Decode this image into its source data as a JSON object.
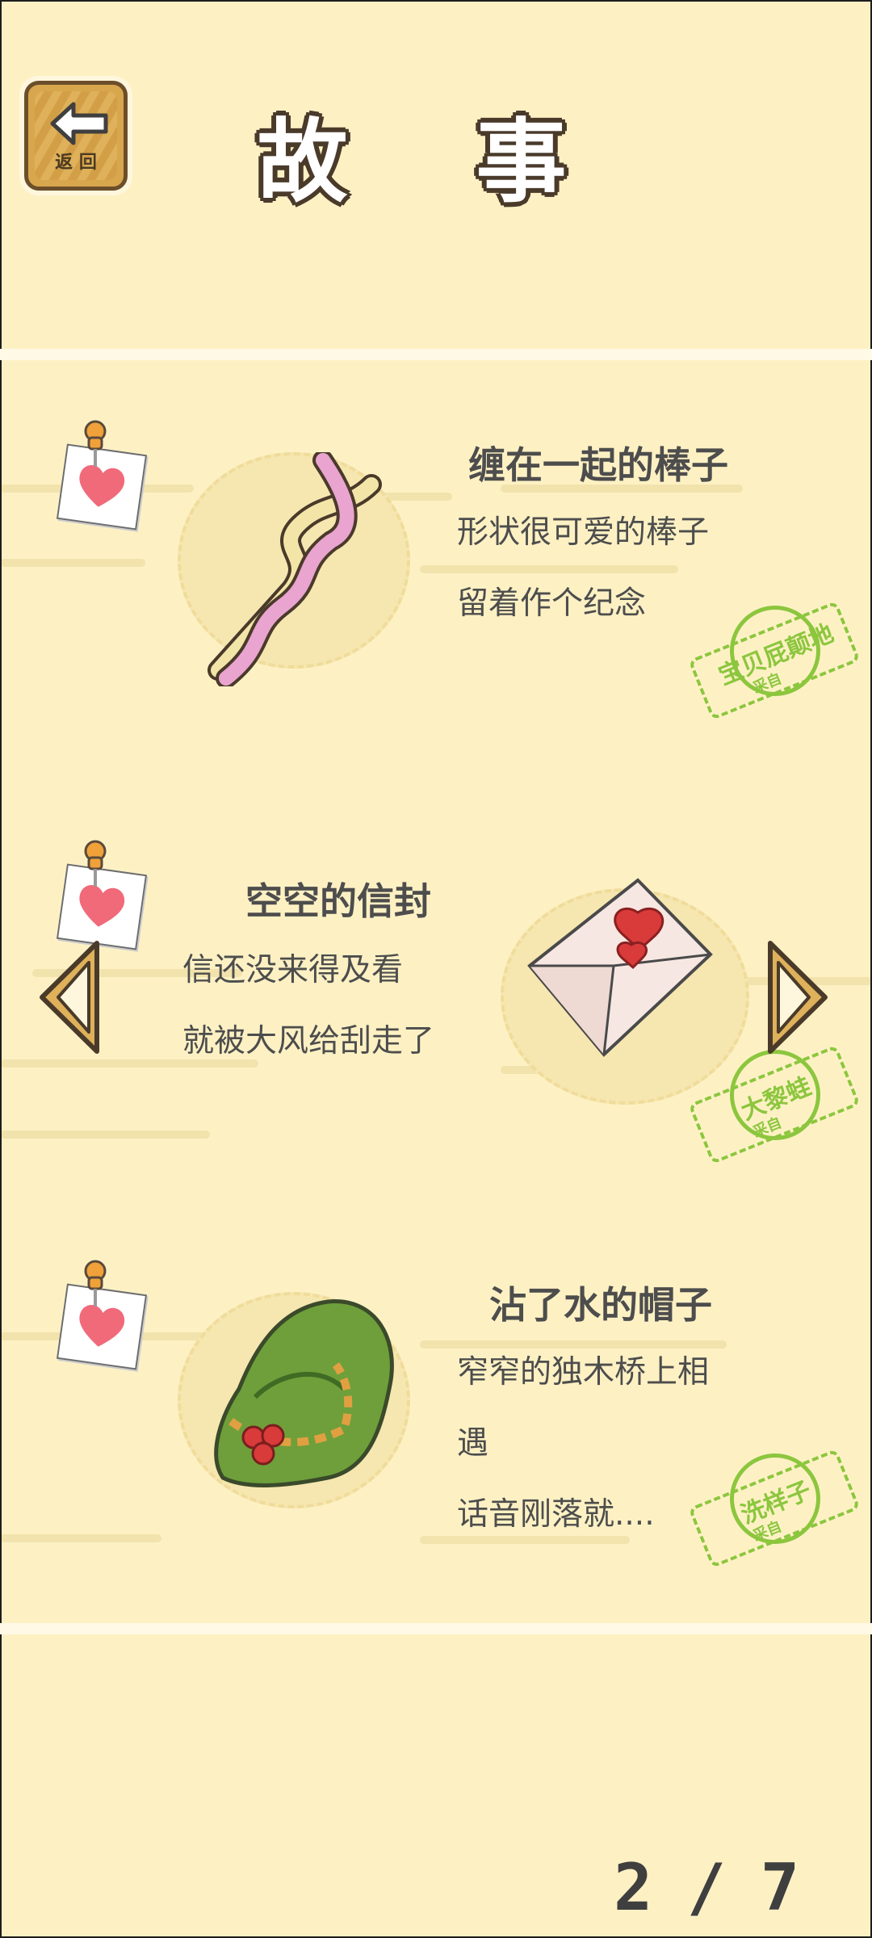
{
  "header": {
    "title": "故 事",
    "back_label": "返 回"
  },
  "stories": [
    {
      "title": "缠在一起的棒子",
      "lines": [
        "形状很可爱的棒子",
        "留着作个纪念"
      ],
      "stamp": {
        "name": "宝贝屁颠地",
        "sub": "采自"
      },
      "icon": "twisted-sticks-icon"
    },
    {
      "title": "空空的信封",
      "lines": [
        "信还没来得及看",
        "就被大风给刮走了"
      ],
      "stamp": {
        "name": "大黎蛙",
        "sub": "采自"
      },
      "icon": "envelope-icon"
    },
    {
      "title": "沾了水的帽子",
      "lines": [
        "窄窄的独木桥上相",
        "遇",
        "话音刚落就...."
      ],
      "stamp": {
        "name": "洗样子",
        "sub": "采自"
      },
      "icon": "green-hat-icon"
    }
  ],
  "pagination": {
    "current": "2",
    "separator": "/",
    "total": "7"
  },
  "colors": {
    "background": "#fdf1c4",
    "stamp_green": "#8cc63e",
    "heart": "#f06a7a"
  }
}
